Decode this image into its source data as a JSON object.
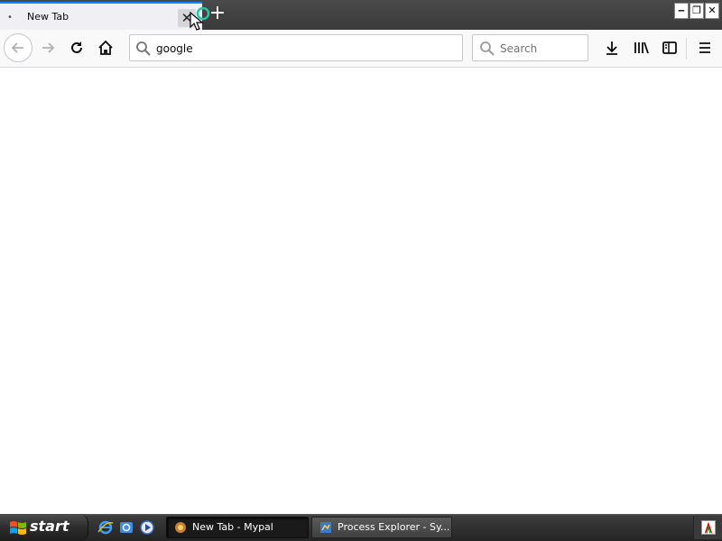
{
  "tabstrip": {
    "tab": {
      "title": "New Tab",
      "dot": "•",
      "close_glyph": "✕"
    },
    "new_tab_glyph": "+",
    "window_controls": {
      "minimize": "‒",
      "restore": "❐",
      "close": "✕"
    }
  },
  "toolbar": {
    "urlbar": {
      "value": "google",
      "icon": "search-icon"
    },
    "searchbar": {
      "placeholder": "Search",
      "icon": "search-icon"
    },
    "icons": [
      "back-icon",
      "forward-icon",
      "reload-icon",
      "home-icon",
      "download-icon",
      "library-icon",
      "sidebar-icon",
      "menu-icon"
    ]
  },
  "taskbar": {
    "start_label": "start",
    "tasks": [
      {
        "label": "New Tab - Mypal",
        "active": true
      },
      {
        "label": "Process Explorer - Sy...",
        "active": false
      }
    ]
  },
  "colors": {
    "tab_accent": "#0a84ff",
    "titlebar": "#3a3a3a",
    "toolbar": "#f9f9fa",
    "taskbar": "#2e2e2e"
  }
}
